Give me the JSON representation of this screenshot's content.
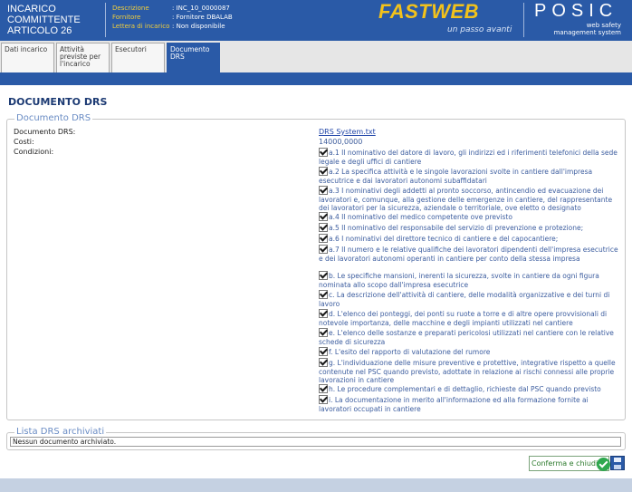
{
  "header": {
    "title_lines": [
      "INCARICO",
      "COMMITTENTE",
      "ARTICOLO 26"
    ],
    "info": [
      {
        "label": "Descrizione",
        "value": ": INC_10_0000087"
      },
      {
        "label": "Fornitore",
        "value": ": Fornitore DBALAB"
      },
      {
        "label": "Lettera di incarico",
        "value": ": Non disponibile"
      }
    ],
    "brand": "FASTWEB",
    "brand_tagline": "un passo avanti",
    "product": "POSIC",
    "product_sub": [
      "web safety",
      "management system"
    ]
  },
  "tabs": [
    {
      "label": "Dati incarico"
    },
    {
      "label": "Attività previste per l'incarico"
    },
    {
      "label": "Esecutori"
    },
    {
      "label": "Documento DRS",
      "active": true
    }
  ],
  "page_title": "DOCUMENTO DRS",
  "documento": {
    "legend": "Documento DRS",
    "fields": [
      {
        "label": "Documento DRS:",
        "value": "DRS System.txt"
      },
      {
        "label": "Costi:",
        "value": "14000,0000"
      },
      {
        "label": "Condizioni:",
        "value": ""
      }
    ],
    "conditions": [
      "a.1 Il nominativo del datore di lavoro, gli indirizzi ed i riferimenti telefonici della sede legale e degli uffici di cantiere",
      "a.2 La specifica attività e le singole lavorazioni svolte in cantiere dall'impresa esecutrice e dai lavoratori autonomi subaffidatari",
      "a.3 I nominativi degli addetti al pronto soccorso, antincendio ed evacuazione dei lavoratori e, comunque, alla gestione delle emergenze in cantiere, del rappresentante dei lavoratori per la sicurezza, aziendale o territoriale, ove eletto o designato",
      "a.4 Il nominativo del medico competente ove previsto",
      "a.5 Il nominativo del responsabile del servizio di prevenzione e protezione;",
      "a.6 I nominativi del direttore tecnico di cantiere e del capocantiere;",
      "a.7 Il numero e le relative qualifiche dei lavoratori dipendenti dell'impresa esecutrice e dei lavoratori autonomi operanti in cantiere per conto della stessa impresa",
      "b. Le specifiche mansioni, inerenti la sicurezza, svolte in cantiere da ogni figura nominata allo scopo dall'impresa esecutrice",
      "c. La descrizione dell'attività di cantiere, delle modalità organizzative e dei turni di lavoro",
      "d. L'elenco dei ponteggi, dei ponti su ruote a torre e di altre opere provvisionali di notevole importanza, delle macchine e degli impianti utilizzati nel cantiere",
      "e. L'elenco delle sostanze e preparati pericolosi utilizzati nel cantiere con le relative schede di sicurezza",
      "f. L'esito del rapporto di valutazione del rumore",
      "g. L'individuazione delle misure preventive e protettive, integrative rispetto a quelle contenute nel PSC quando previsto, adottate in relazione ai rischi connessi alle proprie lavorazioni in cantiere",
      "h. Le procedure complementari e di dettaglio, richieste dal PSC quando previsto",
      "i. La documentazione in merito all'informazione ed alla formazione fornite ai lavoratori occupati in cantiere"
    ]
  },
  "archivio": {
    "legend": "Lista DRS archiviati",
    "empty_text": "Nessun documento archiviato."
  },
  "actions": {
    "confirm_label": "Conferma e chiudi"
  }
}
